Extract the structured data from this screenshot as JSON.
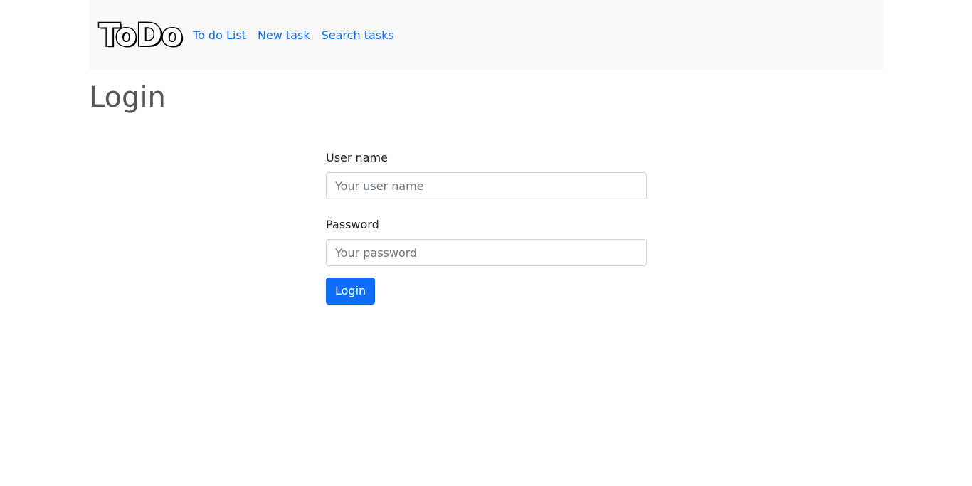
{
  "navbar": {
    "logo_text": "ToDo",
    "links": [
      {
        "label": "To do List"
      },
      {
        "label": "New task"
      },
      {
        "label": "Search tasks"
      }
    ]
  },
  "page": {
    "title": "Login"
  },
  "form": {
    "username": {
      "label": "User name",
      "placeholder": "Your user name",
      "value": ""
    },
    "password": {
      "label": "Password",
      "placeholder": "Your password",
      "value": ""
    },
    "submit_label": "Login"
  },
  "colors": {
    "primary": "#0d6efd",
    "navbar_bg": "#f8f9fa",
    "title": "#555555"
  }
}
